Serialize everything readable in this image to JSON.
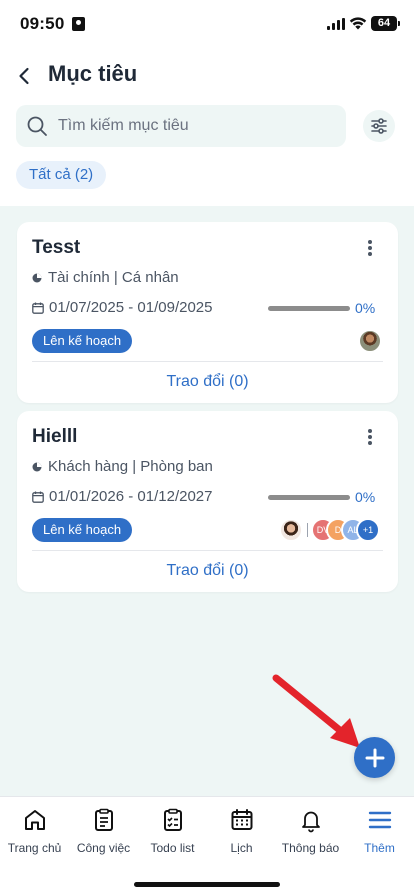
{
  "status_bar": {
    "time": "09:50",
    "battery": "64"
  },
  "header": {
    "title": "Mục tiêu"
  },
  "search": {
    "placeholder": "Tìm kiếm mục tiêu"
  },
  "filter_chip": {
    "label": "Tất cả (2)"
  },
  "goals": [
    {
      "title": "Tesst",
      "category": "Tài chính | Cá nhân",
      "date_range": "01/07/2025 - 01/09/2025",
      "progress": 0,
      "progress_label": "0%",
      "status": "Lên kế hoạch",
      "discussion": "Trao đổi (0)"
    },
    {
      "title": "Hielll",
      "category": "Khách hàng | Phòng ban",
      "date_range": "01/01/2026 - 01/12/2027",
      "progress": 0,
      "progress_label": "0%",
      "status": "Lên kế hoạch",
      "discussion": "Trao đổi (0)",
      "member_avatars": [
        {
          "initials": "DV",
          "color": "#e57373"
        },
        {
          "initials": "D",
          "color": "#f4a261"
        },
        {
          "initials": "AL",
          "color": "#90b4e8"
        },
        {
          "initials": "+1",
          "color": "#2f6fc7"
        }
      ]
    }
  ],
  "bottom_nav": [
    {
      "label": "Trang chủ",
      "icon": "home-icon"
    },
    {
      "label": "Công việc",
      "icon": "clipboard-icon"
    },
    {
      "label": "Todo list",
      "icon": "checklist-icon"
    },
    {
      "label": "Lịch",
      "icon": "calendar-icon"
    },
    {
      "label": "Thông báo",
      "icon": "bell-icon"
    },
    {
      "label": "Thêm",
      "icon": "menu-icon",
      "active": true
    }
  ],
  "colors": {
    "accent": "#2f6fc7",
    "background": "#eef6f5",
    "arrow": "#e3242b"
  }
}
